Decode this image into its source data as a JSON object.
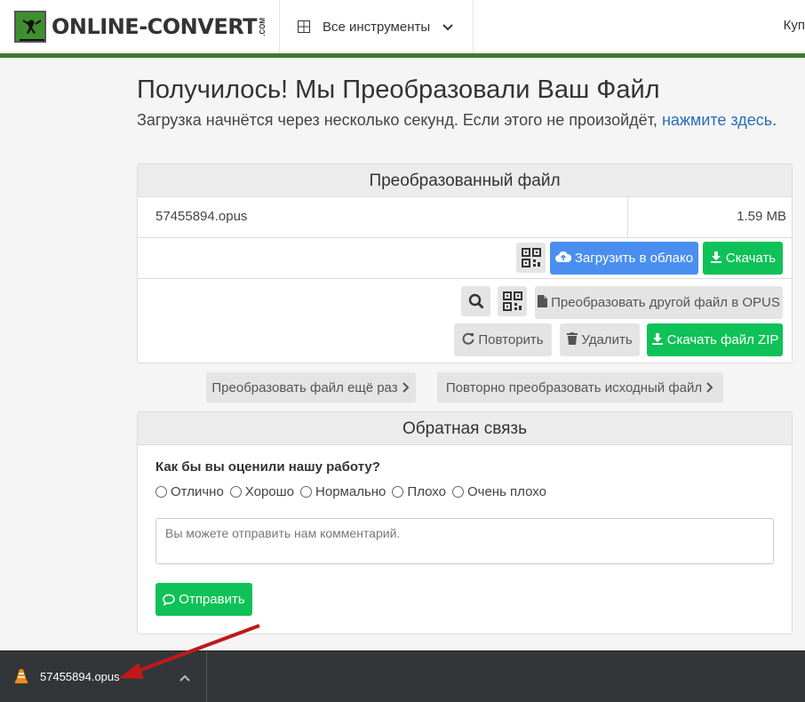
{
  "header": {
    "logo_text": "ONLINE-CONVERT",
    "logo_suffix": ".COM",
    "tools_label": "Все инструменты",
    "right_label": "Куп"
  },
  "main": {
    "title": "Получилось! Мы Преобразовали Ваш Файл",
    "subtitle": "Загрузка начнётся через несколько секунд. Если этого не произойдёт, ",
    "subtitle_link": "нажмите здесь",
    "subtitle_end": "."
  },
  "converted": {
    "heading": "Преобразованный файл",
    "file_name": "57455894.opus",
    "file_size": "1.59 MB",
    "cloud_label": "Загрузить в облако",
    "download_label": "Скачать",
    "convert_other_label": "Преобразовать другой файл в OPUS",
    "repeat_label": "Повторить",
    "delete_label": "Удалить",
    "zip_label": "Скачать файл ZIP"
  },
  "secondary": {
    "again_label": "Преобразовать файл ещё раз",
    "reconvert_label": "Повторно преобразовать исходный файл"
  },
  "feedback": {
    "heading": "Обратная связь",
    "question": "Как бы вы оценили нашу работу?",
    "options": [
      "Отлично",
      "Хорошо",
      "Нормально",
      "Плохо",
      "Очень плохо"
    ],
    "comment_placeholder": "Вы можете отправить нам комментарий.",
    "send_label": "Отправить"
  },
  "download_bar": {
    "file_name": "57455894.opus"
  },
  "colors": {
    "green": "#0ec257",
    "blue": "#4a8ff0",
    "header_line": "#3a7d2e",
    "arrow": "#c0191b"
  }
}
